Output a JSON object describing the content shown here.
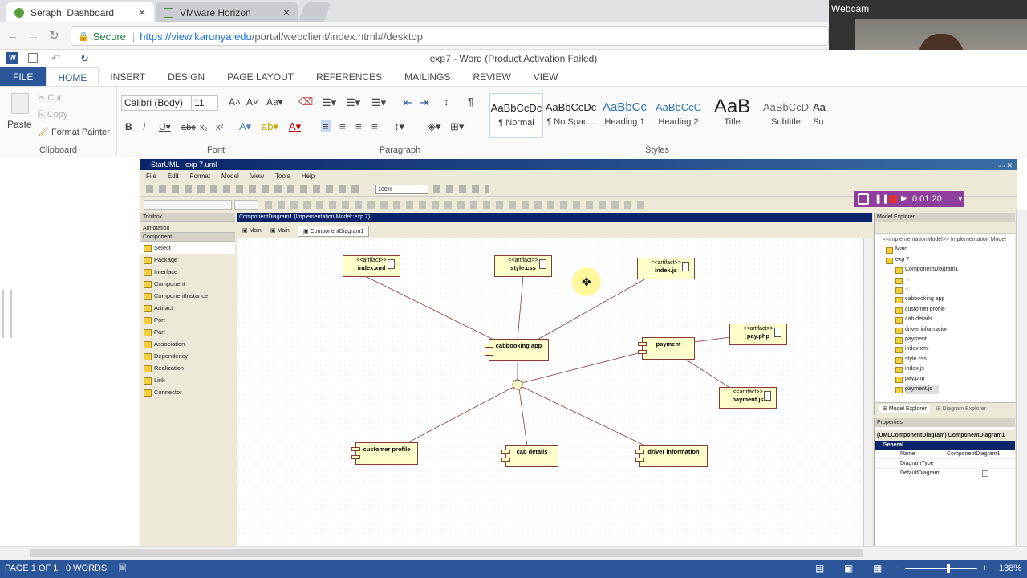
{
  "browser": {
    "tabs": [
      {
        "label": "Seraph: Dashboard"
      },
      {
        "label": "VMware Horizon"
      }
    ],
    "secure_label": "Secure",
    "url_host": "https://view.karunya.edu",
    "url_path": "/portal/webclient/index.html#/desktop"
  },
  "webcam": {
    "label": "Webcam"
  },
  "word": {
    "title": "exp7 - Word (Product Activation Failed)",
    "tabs": [
      "FILE",
      "HOME",
      "INSERT",
      "DESIGN",
      "PAGE LAYOUT",
      "REFERENCES",
      "MAILINGS",
      "REVIEW",
      "VIEW"
    ],
    "clipboard": {
      "paste": "Paste",
      "cut": "Cut",
      "copy": "Copy",
      "format_painter": "Format Painter",
      "label": "Clipboard"
    },
    "font": {
      "name": "Calibri (Body)",
      "size": "11",
      "label": "Font"
    },
    "paragraph_label": "Paragraph",
    "styles_label": "Styles",
    "styles": [
      {
        "preview": "AaBbCcDc",
        "name": "¶ Normal"
      },
      {
        "preview": "AaBbCcDc",
        "name": "¶ No Spac..."
      },
      {
        "preview": "AaBbCc",
        "name": "Heading 1"
      },
      {
        "preview": "AaBbCcC",
        "name": "Heading 2"
      },
      {
        "preview": "AaB",
        "name": "Title"
      },
      {
        "preview": "AaBbCcD",
        "name": "Subtitle"
      },
      {
        "preview": "Aa",
        "name": "Su"
      }
    ],
    "status": {
      "page": "PAGE 1 OF 1",
      "words": "0 WORDS",
      "zoom": "188%"
    }
  },
  "staruml": {
    "title": "StarUML - exp 7.uml",
    "menu": [
      "File",
      "Edit",
      "Format",
      "Model",
      "View",
      "Tools",
      "Help"
    ],
    "zoom": "100%",
    "recording_time": "0:01:20",
    "toolbox": {
      "header": "Toolbox",
      "section1": "Annotation",
      "section2": "Component",
      "items": [
        "Select",
        "Package",
        "Interface",
        "Component",
        "ComponentInstance",
        "Artifact",
        "Port",
        "Part",
        "Association",
        "Dependency",
        "Realization",
        "Link",
        "Connector"
      ]
    },
    "diagram_title": "ComponentDiagram1 (Implementation Model::exp 7)",
    "diagram_tabs": [
      "Main",
      "Main",
      "ComponentDiagram1"
    ],
    "nodes": {
      "index_xml": "index.xml",
      "style_css": "style.css",
      "index_js": "index.js",
      "cabbooking": "cabbooking app",
      "payment": "payment",
      "pay_php": "pay.php",
      "payment_js": "payment.js",
      "customer": "customer profile",
      "cab": "cab details",
      "driver": "driver information",
      "stereotype": "<<artifact>>"
    },
    "model_explorer": {
      "header": "Model Explorer",
      "items": [
        "<<implementationModel>> Implementation Model",
        "Main",
        "exp 7",
        "ComponentDiagram1",
        "cabbooking app",
        "customer profile",
        "cab details",
        "driver information",
        "payment",
        "index.xml",
        "style.css",
        "index.js",
        "pay.php",
        "payment.js"
      ],
      "tabs": [
        "Model Explorer",
        "Diagram Explorer"
      ]
    },
    "properties": {
      "header": "Properties",
      "title": "(UMLComponentDiagram) ComponentDiagram1",
      "group": "General",
      "rows": [
        {
          "key": "Name",
          "value": "ComponentDiagram1"
        },
        {
          "key": "DiagramType",
          "value": ""
        },
        {
          "key": "DefaultDiagram",
          "value": ""
        }
      ]
    }
  }
}
